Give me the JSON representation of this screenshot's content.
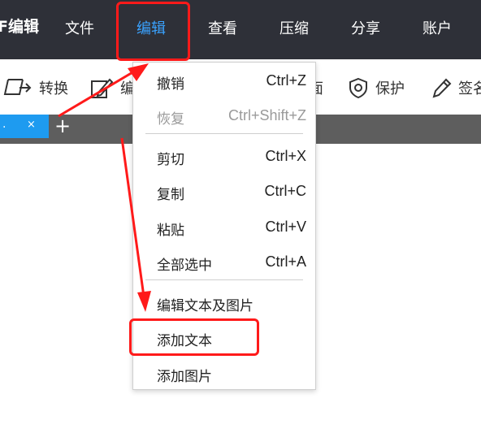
{
  "app": {
    "title": "PDF编辑"
  },
  "menubar": {
    "items": [
      "文件",
      "编辑",
      "查看",
      "压缩",
      "分享",
      "账户"
    ],
    "active": "编辑"
  },
  "toolbar": {
    "convert": "转换",
    "edit_partial": "编",
    "page_partial": "面",
    "protect": "保护",
    "sign_partial": "签名"
  },
  "tabs": {
    "tab_label": ".",
    "close_glyph": "×",
    "add_glyph": "+"
  },
  "dropdown": {
    "items": [
      {
        "label": "撤销",
        "shortcut": "Ctrl+Z",
        "enabled": true
      },
      {
        "label": "恢复",
        "shortcut": "Ctrl+Shift+Z",
        "enabled": false
      },
      {
        "label": "剪切",
        "shortcut": "Ctrl+X",
        "enabled": true
      },
      {
        "label": "复制",
        "shortcut": "Ctrl+C",
        "enabled": true
      },
      {
        "label": "粘贴",
        "shortcut": "Ctrl+V",
        "enabled": true
      },
      {
        "label": "全部选中",
        "shortcut": "Ctrl+A",
        "enabled": true
      },
      {
        "label": "编辑文本及图片",
        "shortcut": "",
        "enabled": true
      },
      {
        "label": "添加文本",
        "shortcut": "",
        "enabled": true
      },
      {
        "label": "添加图片",
        "shortcut": "",
        "enabled": true
      }
    ]
  },
  "annotation": {
    "highlighted": [
      "编辑",
      "添加文本"
    ],
    "color": "#ff1a1a"
  },
  "colors": {
    "menubar_bg": "#2e3038",
    "active_menu": "#3aa2ff",
    "tab_active": "#1e9bf0",
    "tabstrip_bg": "#5e5e5e"
  }
}
